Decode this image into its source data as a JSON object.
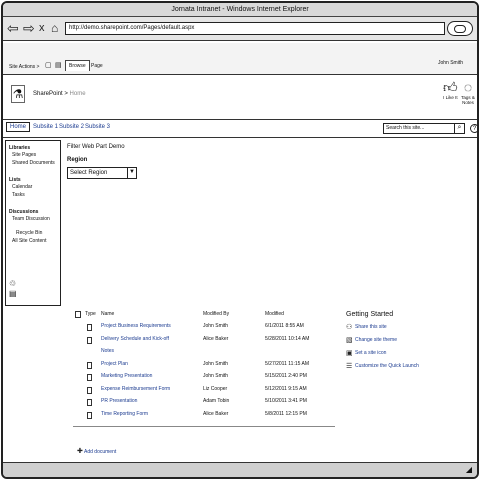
{
  "window": {
    "title": "Jornata Intranet - Windows Internet Explorer"
  },
  "browser": {
    "url": "http://demo.sharepoint.com/Pages/default.aspx",
    "back_icon": "back-arrow-icon",
    "forward_icon": "forward-arrow-icon",
    "stop_icon": "x",
    "home_icon": "home-icon"
  },
  "ribbon": {
    "site_actions": "Site Actions >",
    "tab_browse": "Browse",
    "tab_page": "Page",
    "user": "John Smith"
  },
  "header": {
    "site_name": "SharePoint >",
    "current": "Home",
    "like_label": "I Like It",
    "tags_label": "Tags & Notes"
  },
  "topnav": {
    "items": [
      "Home",
      "Subsite 1",
      "Subsite 2",
      "Subsite 3"
    ],
    "search_placeholder": "Search this site..."
  },
  "quicklaunch": {
    "libraries_heading": "Libraries",
    "libraries": [
      "Site Pages",
      "Shared Documents"
    ],
    "lists_heading": "Lists",
    "lists": [
      "Calendar",
      "Tasks"
    ],
    "discussions_heading": "Discussions",
    "discussions": [
      "Team Discussion"
    ],
    "extras": [
      "Recycle Bin",
      "All Site Content"
    ]
  },
  "filter": {
    "title": "Filter Web Part Demo",
    "region_label": "Region",
    "select_value": "Select Region"
  },
  "doclib": {
    "headers": {
      "type": "Type",
      "name": "Name",
      "modified_by": "Modified By",
      "modified": "Modified"
    },
    "rows": [
      {
        "name": "Project Business Requirements",
        "name2": "",
        "by": "John Smith",
        "date": "6/1/2011 8:55 AM"
      },
      {
        "name": "Delivery Schedule and Kick-off",
        "name2": "Notes",
        "by": "Alice Baker",
        "date": "5/28/2011 10:14 AM"
      },
      {
        "name": "Project Plan",
        "name2": "",
        "by": "John Smith",
        "date": "5/27/2011 11:15 AM"
      },
      {
        "name": "Marketing Presentation",
        "name2": "",
        "by": "John Smith",
        "date": "5/15/2011 2:40 PM"
      },
      {
        "name": "Expense Reimbursement Form",
        "name2": "",
        "by": "Liz Cooper",
        "date": "5/12/2011 9:15 AM"
      },
      {
        "name": "PR Presentation",
        "name2": "",
        "by": "Adam Tobin",
        "date": "5/10/2011 3:41 PM"
      },
      {
        "name": "Time Reporting Form",
        "name2": "",
        "by": "Alice Baker",
        "date": "5/8/2011 12:15 PM"
      }
    ],
    "add_document": "Add document"
  },
  "getting_started": {
    "title": "Getting Started",
    "items": [
      {
        "label": "Share this site",
        "icon": "share-icon"
      },
      {
        "label": "Change site theme",
        "icon": "theme-icon"
      },
      {
        "label": "Set a site icon",
        "icon": "image-icon"
      },
      {
        "label": "Customize the Quick Launch",
        "icon": "list-icon"
      }
    ]
  }
}
